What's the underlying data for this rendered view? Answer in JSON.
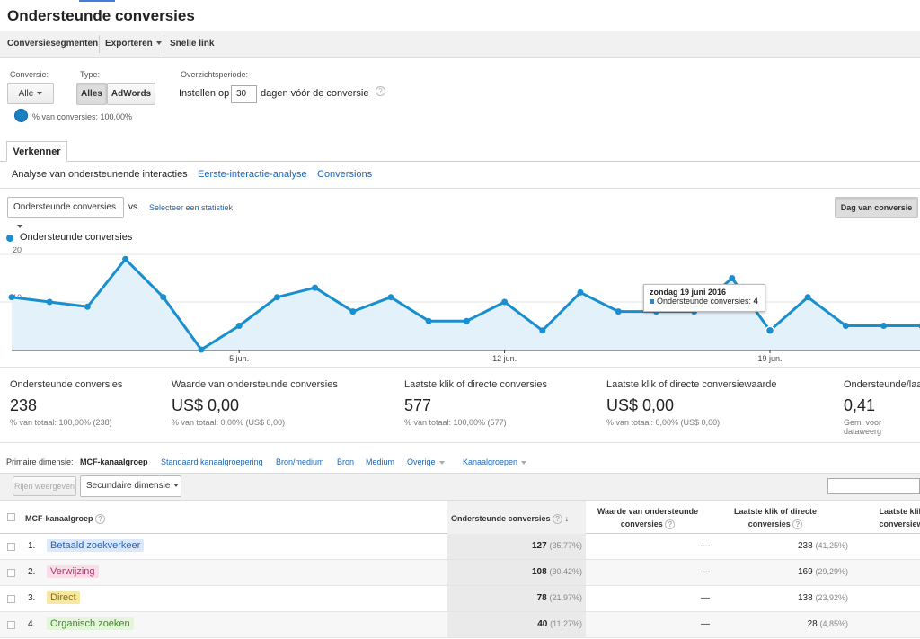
{
  "page_title": "Ondersteunde conversies",
  "toolbar": {
    "segments": "Conversiesegmenten",
    "export": "Exporteren",
    "shortcut": "Snelle link"
  },
  "filters": {
    "conversion_label": "Conversie:",
    "conversion_value": "Alle",
    "type_label": "Type:",
    "type_all": "Alles",
    "type_adwords": "AdWords",
    "period_label": "Overzichtsperiode:",
    "period_prefix": "Instellen op",
    "period_value": "30",
    "period_suffix": "dagen vóór de conversie",
    "pct_conversions": "% van conversies: 100,00%"
  },
  "tab_explorer": "Verkenner",
  "subnav": {
    "item1": "Analyse van ondersteunende interacties",
    "item2": "Eerste-interactie-analyse",
    "item3": "Conversions"
  },
  "chart_controls": {
    "metric": "Ondersteunde conversies",
    "vs": "vs.",
    "select_metric": "Selecteer een statistiek",
    "day_button": "Dag van conversie"
  },
  "chart_data": {
    "type": "area",
    "series": [
      {
        "name": "Ondersteunde conversies",
        "values": [
          11,
          10,
          9,
          19,
          11,
          0,
          5,
          11,
          13,
          8,
          11,
          6,
          6,
          10,
          4,
          12,
          8,
          8,
          8,
          15,
          4,
          11,
          5,
          5,
          5
        ]
      }
    ],
    "x_ticks": [
      {
        "index": 6,
        "label": "5 jun."
      },
      {
        "index": 13,
        "label": "12 jun."
      },
      {
        "index": 20,
        "label": "19 jun."
      }
    ],
    "y_ticks": [
      10,
      20
    ],
    "ylim": [
      0,
      20
    ],
    "color": "#1a8fcf",
    "fill": "#e3f1fa",
    "grid": true,
    "highlight_index": 20
  },
  "tooltip": {
    "date": "zondag 19 juni 2016",
    "series": "Ondersteunde conversies:",
    "value": "4"
  },
  "stats": [
    {
      "label": "Ondersteunde conversies",
      "value": "238",
      "sub": "% van totaal: 100,00% (238)"
    },
    {
      "label": "Waarde van ondersteunde conversies",
      "value": "US$ 0,00",
      "sub": "% van totaal: 0,00% (US$ 0,00)"
    },
    {
      "label": "Laatste klik of directe conversies",
      "value": "577",
      "sub": "% van totaal: 100,00% (577)"
    },
    {
      "label": "Laatste klik of directe conversiewaarde",
      "value": "US$ 0,00",
      "sub": "% van totaal: 0,00% (US$ 0,00)"
    },
    {
      "label": "Ondersteunde/laa",
      "value": "0,41",
      "sub": "Gem. voor dataweerg"
    }
  ],
  "dimensions": {
    "label": "Primaire dimensie:",
    "active": "MCF-kanaalgroep",
    "d1": "Standaard kanaalgroepering",
    "d2": "Bron/medium",
    "d3": "Bron",
    "d4": "Medium",
    "d5": "Overige",
    "d6": "Kanaalgroepen"
  },
  "table_toolbar": {
    "show_rows": "Rijen weergeven",
    "secondary": "Secundaire dimensie"
  },
  "table": {
    "headers": {
      "dim": "MCF-kanaalgroep",
      "assisted": "Ondersteunde conversies",
      "assisted_value_1": "Waarde van ondersteunde",
      "assisted_value_2": "conversies",
      "last_click_1": "Laatste klik of directe",
      "last_click_2": "conversies",
      "last_click_value_1": "Laatste klik",
      "last_click_value_2": "conversiew"
    },
    "rows": [
      {
        "idx": "1.",
        "channel": "Betaald zoekverkeer",
        "color": "#dbe9fb",
        "text_color": "#2a62b5",
        "assisted": "127",
        "assisted_pct": "(35,77%)",
        "value": "—",
        "last": "238",
        "last_pct": "(41,25%)"
      },
      {
        "idx": "2.",
        "channel": "Verwijzing",
        "color": "#f9dde8",
        "text_color": "#b0386a",
        "assisted": "108",
        "assisted_pct": "(30,42%)",
        "value": "—",
        "last": "169",
        "last_pct": "(29,29%)"
      },
      {
        "idx": "3.",
        "channel": "Direct",
        "color": "#f6e7a2",
        "text_color": "#8a6d0a",
        "assisted": "78",
        "assisted_pct": "(21,97%)",
        "value": "—",
        "last": "138",
        "last_pct": "(23,92%)"
      },
      {
        "idx": "4.",
        "channel": "Organisch zoeken",
        "color": "#e4f5dc",
        "text_color": "#3f8a28",
        "assisted": "40",
        "assisted_pct": "(11,27%)",
        "value": "—",
        "last": "28",
        "last_pct": "(4,85%)"
      }
    ]
  }
}
